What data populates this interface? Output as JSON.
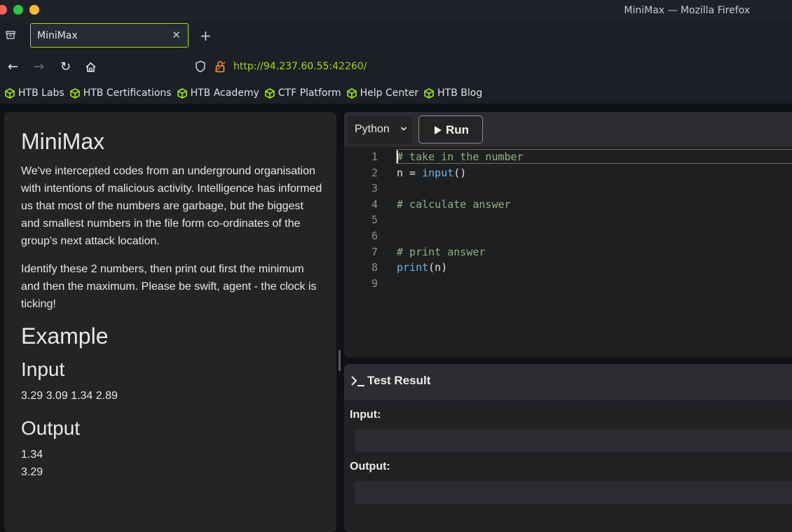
{
  "window": {
    "title": "MiniMax — Mozilla Firefox",
    "traffic_lights": {
      "close": "#fe5f57",
      "minimize": "#28c840",
      "maximize": "#febc2e"
    }
  },
  "tabs": [
    {
      "title": "MiniMax",
      "active": true
    }
  ],
  "navbar": {
    "url_scheme": "http://",
    "url_host": "94.237.60.55",
    "url_port": ":42260/",
    "accent_color": "#a4e000"
  },
  "bookmarks": [
    {
      "label": "HTB Labs",
      "icon": "htb-cube-icon"
    },
    {
      "label": "HTB Certifications",
      "icon": "htb-cube-icon"
    },
    {
      "label": "HTB Academy",
      "icon": "htb-cube-icon"
    },
    {
      "label": "CTF Platform",
      "icon": "htb-cube-icon"
    },
    {
      "label": "Help Center",
      "icon": "htb-cube-icon"
    },
    {
      "label": "HTB Blog",
      "icon": "htb-cube-icon"
    }
  ],
  "problem": {
    "title": "MiniMax",
    "paragraphs": [
      "We've intercepted codes from an underground organisation with intentions of malicious activity. Intelligence has informed us that most of the numbers are garbage, but the biggest and smallest numbers in the file form co-ordinates of the group's next attack location.",
      "Identify these 2 numbers, then print out first the minimum and then the maximum. Please be swift, agent - the clock is ticking!"
    ],
    "example_heading": "Example",
    "input_heading": "Input",
    "input_value": "3.29 3.09 1.34 2.89",
    "output_heading": "Output",
    "output_lines": [
      "1.34",
      "3.29"
    ]
  },
  "editor": {
    "language": "Python",
    "run_label": "Run",
    "lines": [
      {
        "n": "1",
        "text": "# take in the number"
      },
      {
        "n": "2",
        "text": "n = input()"
      },
      {
        "n": "3",
        "text": ""
      },
      {
        "n": "4",
        "text": "# calculate answer"
      },
      {
        "n": "5",
        "text": ""
      },
      {
        "n": "6",
        "text": ""
      },
      {
        "n": "7",
        "text": "# print answer"
      },
      {
        "n": "8",
        "text": "print(n)"
      },
      {
        "n": "9",
        "text": ""
      }
    ]
  },
  "result": {
    "title": "Test Result",
    "input_label": "Input:",
    "input_value": "",
    "output_label": "Output:",
    "output_value": ""
  }
}
